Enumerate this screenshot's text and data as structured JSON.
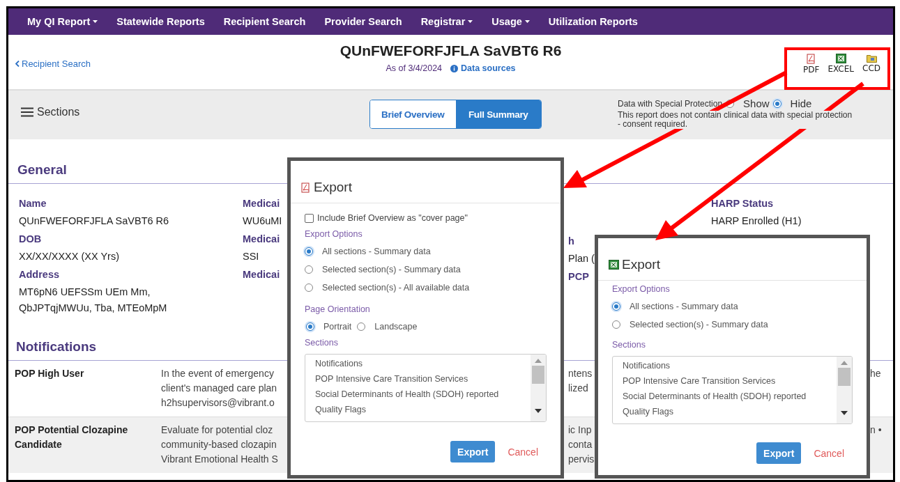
{
  "nav": [
    {
      "label": "My QI Report",
      "dropdown": true
    },
    {
      "label": "Statewide Reports",
      "dropdown": false
    },
    {
      "label": "Recipient Search",
      "dropdown": false
    },
    {
      "label": "Provider Search",
      "dropdown": false
    },
    {
      "label": "Registrar",
      "dropdown": true
    },
    {
      "label": "Usage",
      "dropdown": true
    },
    {
      "label": "Utilization Reports",
      "dropdown": false
    }
  ],
  "header": {
    "back_link": "Recipient Search",
    "title": "QUnFWEFORFJFLA SaVBT6 R6",
    "as_of": "As of 3/4/2024",
    "data_sources": "Data sources",
    "exports": [
      {
        "label": "PDF",
        "kind": "pdf"
      },
      {
        "label": "EXCEL",
        "kind": "excel"
      },
      {
        "label": "CCD",
        "kind": "ccd"
      }
    ]
  },
  "toolbar": {
    "sections_label": "Sections",
    "view_tabs": [
      {
        "label": "Brief Overview",
        "selected": false
      },
      {
        "label": "Full Summary",
        "selected": true
      }
    ],
    "special_protection": {
      "label": "Data with Special Protection",
      "options": [
        {
          "label": "Show",
          "selected": false
        },
        {
          "label": "Hide",
          "selected": true
        }
      ],
      "note": "This report does not contain clinical data with special protection - consent required."
    }
  },
  "general": {
    "heading": "General",
    "columns": [
      [
        {
          "kind": "label",
          "text": "Name"
        },
        {
          "kind": "value",
          "text": "QUnFWEFORFJFLA SaVBT6 R6"
        },
        {
          "kind": "label",
          "text": "DOB"
        },
        {
          "kind": "value",
          "text": "XX/XX/XXXX (XX Yrs)"
        },
        {
          "kind": "label",
          "text": "Address"
        },
        {
          "kind": "value",
          "text": "MT6pN6 UEFSSm UEm Mm, QbJPTqjMWUu, Tba, MTEoMpM"
        }
      ],
      [
        {
          "kind": "label",
          "text": "Medicai"
        },
        {
          "kind": "value",
          "text": "WU6uMI"
        },
        {
          "kind": "label",
          "text": "Medicai"
        },
        {
          "kind": "value",
          "text": "SSI"
        },
        {
          "kind": "label",
          "text": "Medicai"
        }
      ],
      [
        {
          "kind": "label",
          "text": "h"
        },
        {
          "kind": "value",
          "text": "Plan ("
        },
        {
          "kind": "label",
          "text": "PCP"
        }
      ],
      [
        {
          "kind": "label",
          "text": "HARP Status"
        },
        {
          "kind": "value",
          "text": "HARP Enrolled (H1)"
        }
      ]
    ]
  },
  "notifications": {
    "heading": "Notifications",
    "rows": [
      {
        "name": "POP High User",
        "text_lines": [
          "In the event of emergency",
          "client's managed care plan",
          "h2hsupervisors@vibrant.o"
        ],
        "column_3": [
          "ntens",
          "lized"
        ],
        "column_4": [
          "he"
        ]
      },
      {
        "name": "POP Potential Clozapine Candidate",
        "text_lines": [
          "Evaluate for potential cloz",
          "community-based clozapin",
          "Vibrant Emotional Health S"
        ],
        "column_3": [
          "ic Inp",
          "conta",
          "pervis"
        ],
        "column_4": [
          "n •"
        ]
      }
    ]
  },
  "dialogs": [
    {
      "kind": "pdf",
      "title": "Export",
      "cover_page": {
        "label": "Include Brief Overview as \"cover page\"",
        "checked": false
      },
      "options_heading": "Export Options",
      "options": [
        {
          "label": "All sections - Summary data",
          "selected": true
        },
        {
          "label": "Selected section(s) - Summary data",
          "selected": false
        },
        {
          "label": "Selected section(s) - All available data",
          "selected": false
        }
      ],
      "orientation": {
        "heading": "Page Orientation",
        "options": [
          {
            "label": "Portrait",
            "selected": true
          },
          {
            "label": "Landscape",
            "selected": false
          }
        ]
      },
      "sections_heading": "Sections",
      "sections": [
        "Notifications",
        "POP Intensive Care Transition Services",
        "Social Determinants of Health (SDOH) reported",
        "Quality Flags"
      ],
      "export_button": "Export",
      "cancel_button": "Cancel"
    },
    {
      "kind": "excel",
      "title": "Export",
      "options_heading": "Export Options",
      "options": [
        {
          "label": "All sections - Summary data",
          "selected": true
        },
        {
          "label": "Selected section(s) - Summary data",
          "selected": false
        }
      ],
      "sections_heading": "Sections",
      "sections": [
        "Notifications",
        "POP Intensive Care Transition Services",
        "Social Determinants of Health (SDOH) reported",
        "Quality Flags"
      ],
      "export_button": "Export",
      "cancel_button": "Cancel"
    }
  ]
}
